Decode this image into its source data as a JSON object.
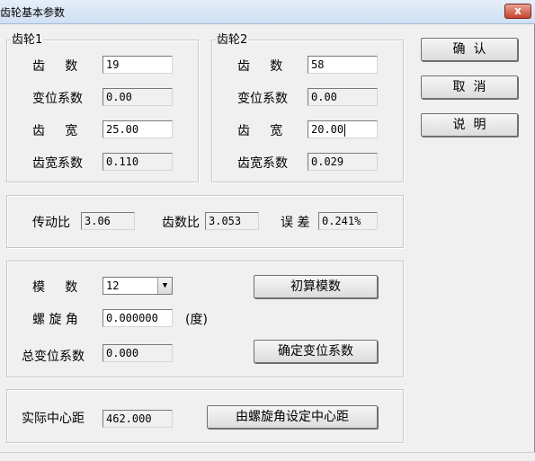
{
  "window": {
    "title": "齿轮基本参数",
    "close_glyph": "x"
  },
  "gear1": {
    "title": "齿轮1",
    "teeth_label": "齿     数",
    "teeth_value": "19",
    "shift_label": "变位系数",
    "shift_value": "0.00",
    "width_label": "齿     宽",
    "width_value": "25.00",
    "width_coef_label": "齿宽系数",
    "width_coef_value": "0.110"
  },
  "gear2": {
    "title": "齿轮2",
    "teeth_label": "齿     数",
    "teeth_value": "58",
    "shift_label": "变位系数",
    "shift_value": "0.00",
    "width_label": "齿     宽",
    "width_value": "20.00",
    "width_coef_label": "齿宽系数",
    "width_coef_value": "0.029"
  },
  "ratio": {
    "transmission_label": "传动比",
    "transmission_value": "3.06",
    "teeth_ratio_label": "齿数比",
    "teeth_ratio_value": "3.053",
    "error_label": "误 差",
    "error_value": "0.241%"
  },
  "module_group": {
    "module_label": "模     数",
    "module_value": "12",
    "helix_label": "螺 旋 角",
    "helix_value": "0.000000",
    "helix_unit": "(度)",
    "total_shift_label": "总变位系数",
    "total_shift_value": "0.000",
    "calc_module_button": "初算模数",
    "set_shift_button": "确定变位系数"
  },
  "center": {
    "label": "实际中心距",
    "value": "462.000",
    "button": "由螺旋角设定中心距"
  },
  "buttons": {
    "ok": "确  认",
    "cancel": "取  消",
    "help": "说  明"
  }
}
